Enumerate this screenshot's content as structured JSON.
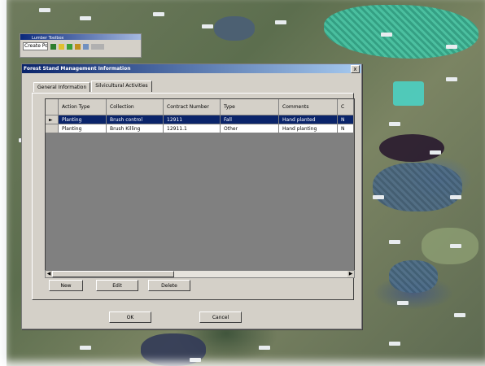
{
  "toolbar": {
    "title": "Lumber Toolbox",
    "select_value": "Create Poly"
  },
  "dialog": {
    "title": "Forest Stand Management Information",
    "close_label": "x",
    "tabs": [
      "General Information",
      "Silvicultural Activities"
    ],
    "grid": {
      "columns": [
        "",
        "Action Type",
        "Collection",
        "Contract Number",
        "Type",
        "Comments",
        "C"
      ],
      "rows": [
        {
          "marker": "►",
          "cells": [
            "Planting",
            "Brush control",
            "12911",
            "Fall",
            "Hand planted",
            "N"
          ]
        },
        {
          "marker": "",
          "cells": [
            "Planting",
            "Brush Killing",
            "12911.1",
            "Other",
            "Hand planting",
            "N"
          ]
        }
      ]
    },
    "buttons": {
      "new": "New",
      "edit": "Edit",
      "delete": "Delete",
      "ok": "OK",
      "cancel": "Cancel"
    }
  },
  "colors": {
    "titlebar_start": "#0a246a",
    "selected_row": "#0a246a",
    "window_face": "#d4d0c8"
  }
}
